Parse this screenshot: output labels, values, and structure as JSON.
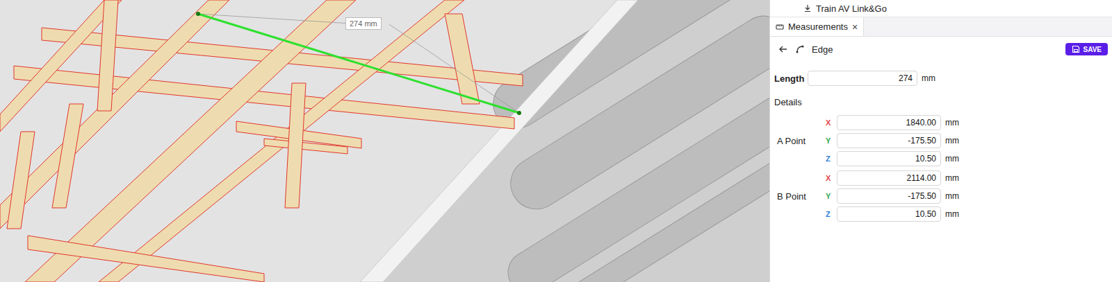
{
  "viewport": {
    "dimension_label": "274 mm"
  },
  "top_item": {
    "label": "Train AV Link&Go"
  },
  "tabs": [
    {
      "label": "Measurements",
      "close": "×",
      "selected": true
    }
  ],
  "toolbar": {
    "title": "Edge",
    "save_button": "SAVE"
  },
  "length": {
    "label": "Length",
    "value": "274",
    "unit": "mm"
  },
  "details": {
    "title": "Details"
  },
  "points": [
    {
      "label": "A Point",
      "coords": [
        {
          "axis": "X",
          "value": "1840.00",
          "unit": "mm",
          "color": "#e5484d"
        },
        {
          "axis": "Y",
          "value": "-175.50",
          "unit": "mm",
          "color": "#2fa84f"
        },
        {
          "axis": "Z",
          "value": "10.50",
          "unit": "mm",
          "color": "#2f7fd8"
        }
      ]
    },
    {
      "label": "B Point",
      "coords": [
        {
          "axis": "X",
          "value": "2114.00",
          "unit": "mm",
          "color": "#e5484d"
        },
        {
          "axis": "Y",
          "value": "-175.50",
          "unit": "mm",
          "color": "#2fa84f"
        },
        {
          "axis": "Z",
          "value": "10.50",
          "unit": "mm",
          "color": "#2f7fd8"
        }
      ]
    }
  ]
}
